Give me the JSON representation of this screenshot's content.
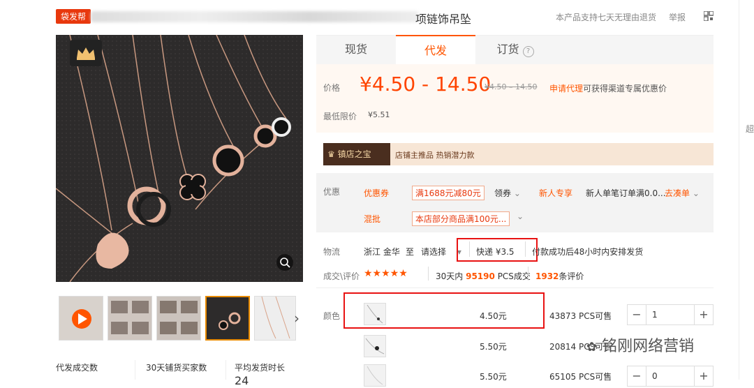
{
  "header": {
    "badge": "袋发帮",
    "title_visible": "项链饰吊坠",
    "return_policy": "本产品支持七天无理由退货",
    "report": "举报"
  },
  "tabs": [
    {
      "label": "现货"
    },
    {
      "label": "代发"
    },
    {
      "label": "订货"
    }
  ],
  "price": {
    "label": "价格",
    "range": "¥4.50 - 14.50",
    "original": "¥4.50 – 14.50",
    "apply_agent": "申请代理",
    "apply_tip": "可获得渠道专属优惠价",
    "min_label": "最低限价",
    "min_value": "¥5.51"
  },
  "promo": {
    "badge": "镇店之宝",
    "text": "店铺主推品 热销潜力款"
  },
  "coupons": {
    "label": "优惠",
    "row1_title": "优惠券",
    "row1_coupon": "满1688元减80元",
    "row1_get": "领券",
    "row1_new": "新人专享",
    "row1_desc": "新人单笔订单满0.0...",
    "row1_link": "去凑单",
    "row2_title": "混批",
    "row2_coupon": "本店部分商品满100元..."
  },
  "logistics": {
    "label": "物流",
    "origin": "浙江 金华",
    "to": "至",
    "select": "请选择",
    "express": "快递 ¥3.5",
    "ship_note": "付款成功后48小时内安排发货"
  },
  "deals": {
    "label": "成交\\评价",
    "stars": "★★★★★",
    "days": "30天内",
    "count": "95190",
    "unit": "PCS成交",
    "reviews": "1932",
    "reviews_unit": "条评价"
  },
  "color": {
    "label": "颜色",
    "rows": [
      {
        "price": "4.50元",
        "stock": "43873 PCS可售",
        "qty": "1"
      },
      {
        "price": "5.50元",
        "stock": "20814 PCS可售",
        "qty": ""
      },
      {
        "price": "5.50元",
        "stock": "65105 PCS可售",
        "qty": "0"
      }
    ]
  },
  "stats": {
    "a": "代发成交数",
    "b": "30天铺货买家数",
    "c": "平均发货时长",
    "c_value": "24"
  },
  "side": {
    "text": "超"
  },
  "watermark": "铭刚网络营销",
  "colors": {
    "accent": "#ff5500",
    "highlight": "#e81212"
  }
}
